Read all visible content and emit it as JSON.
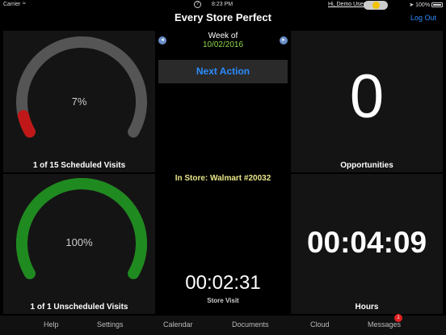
{
  "status_bar": {
    "carrier": "Carrier",
    "wifi_icon": "wifi-icon",
    "time": "8:23 PM",
    "help_icon": "?",
    "battery": "100%",
    "arrow_icon": "location-arrow-icon"
  },
  "header": {
    "title": "Every Store Perfect",
    "user": "Hi, Demo User",
    "logout": "Log Out",
    "toggle_on": true
  },
  "scheduled": {
    "percent": 7,
    "percent_label": "7%",
    "caption": "1 of 15 Scheduled Visits",
    "color": "#c01818"
  },
  "unscheduled": {
    "percent": 100,
    "percent_label": "100%",
    "caption": "1 of 1 Unscheduled Visits",
    "color": "#1f8a1f"
  },
  "center": {
    "week_label": "Week of",
    "week_date": "10/02/2016",
    "prev_arrow": "◂",
    "next_arrow": "▸",
    "next_action": "Next Action",
    "in_store": "In Store: Walmart #20032",
    "visit_timer": "00:02:31",
    "visit_label": "Store Visit"
  },
  "opportunities": {
    "value": "0",
    "caption": "Opportunities"
  },
  "hours": {
    "value": "00:04:09",
    "caption": "Hours"
  },
  "tabs": [
    {
      "label": "Help"
    },
    {
      "label": "Settings"
    },
    {
      "label": "Calendar"
    },
    {
      "label": "Documents"
    },
    {
      "label": "Cloud"
    },
    {
      "label": "Messages"
    }
  ],
  "messages_badge": "1"
}
